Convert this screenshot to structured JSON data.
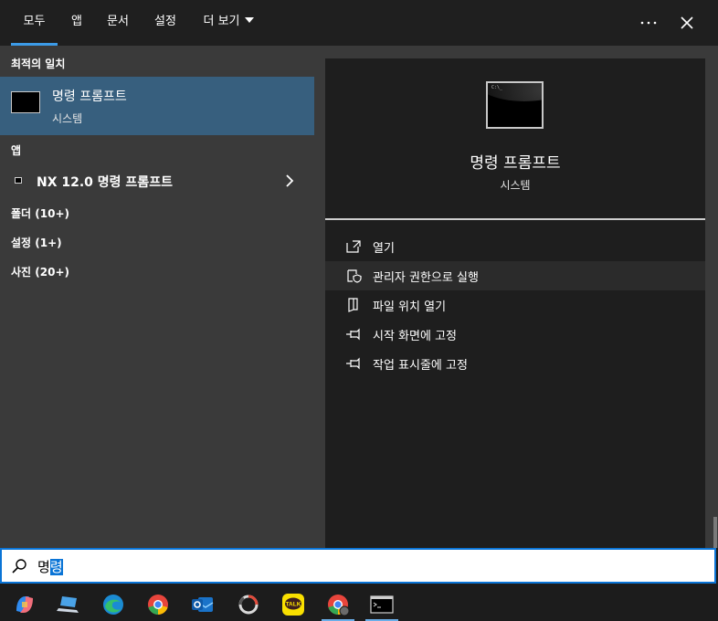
{
  "tabs": [
    {
      "label": "모두",
      "active": true
    },
    {
      "label": "앱"
    },
    {
      "label": "문서"
    },
    {
      "label": "설정"
    },
    {
      "label": "더 보기"
    }
  ],
  "top_buttons": {
    "more_icon": "more-icon",
    "close_icon": "close-icon"
  },
  "left": {
    "best_match_title": "최적의 일치",
    "best_match": {
      "name": "명령 프롬프트",
      "sub": "시스템"
    },
    "apps_title": "앱",
    "apps": [
      {
        "label": "NX 12.0 명령 프롬프트"
      }
    ],
    "categories": [
      {
        "label": "폴더 (10+)"
      },
      {
        "label": "설정 (1+)"
      },
      {
        "label": "사진 (20+)"
      }
    ]
  },
  "right": {
    "title": "명령 프롬프트",
    "sub": "시스템",
    "actions": [
      {
        "label": "열기",
        "icon": "open-icon"
      },
      {
        "label": "관리자 권한으로 실행",
        "icon": "shield-icon"
      },
      {
        "label": "파일 위치 열기",
        "icon": "file-location-icon"
      },
      {
        "label": "시작 화면에 고정",
        "icon": "pin-icon"
      },
      {
        "label": "작업 표시줄에 고정",
        "icon": "pin-icon"
      }
    ]
  },
  "search": {
    "query_plain": "명",
    "query_selected": "령"
  },
  "taskbar": [
    {
      "name": "copilot-icon"
    },
    {
      "name": "laptop-icon"
    },
    {
      "name": "edge-icon"
    },
    {
      "name": "chrome-icon"
    },
    {
      "name": "outlook-icon"
    },
    {
      "name": "loop-icon"
    },
    {
      "name": "kakaotalk-icon",
      "label": "TALK"
    },
    {
      "name": "chrome-profile-icon"
    },
    {
      "name": "command-prompt-icon"
    }
  ],
  "colors": {
    "accent": "#3c9be8",
    "selection": "#375f7e",
    "search_border": "#0a74d6"
  }
}
